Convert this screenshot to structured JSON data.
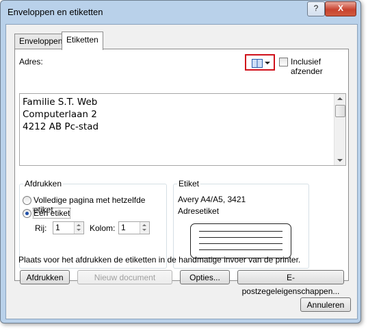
{
  "window": {
    "title": "Enveloppen en etiketten",
    "help_glyph": "?",
    "close_glyph": "X"
  },
  "tabs": [
    {
      "label": "Enveloppen",
      "active": false
    },
    {
      "label": "Etiketten",
      "active": true
    }
  ],
  "address": {
    "label": "Adres:",
    "address_book_icon": "address-book-icon",
    "include_sender_label": "Inclusief afzender",
    "include_sender_checked": false,
    "value": "Familie S.T. Web\nComputerlaan 2\n4212 AB Pc-stad"
  },
  "print_group": {
    "title": "Afdrukken",
    "option_full_page": "Volledige pagina met hetzelfde etiket",
    "option_single": "Eén etiket",
    "selected": "single",
    "row_label": "Rij:",
    "row_value": "1",
    "column_label": "Kolom:",
    "column_value": "1"
  },
  "label_group": {
    "title": "Etiket",
    "name": "Avery A4/A5, 3421",
    "type": "Adresetiket"
  },
  "info_text": "Plaats voor het afdrukken de etiketten in de handmatige invoer van de printer.",
  "buttons": {
    "print": "Afdrukken",
    "new_document": "Nieuw document",
    "options": "Opties...",
    "postage": "E-postzegeleigenschappen...",
    "cancel": "Annuleren"
  },
  "colors": {
    "highlight_border": "#d0101a",
    "close_button": "#c8432f",
    "frame": "#b9d1ea"
  }
}
